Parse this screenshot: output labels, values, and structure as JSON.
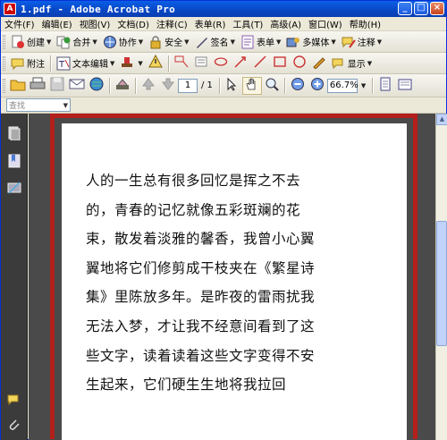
{
  "window": {
    "title": "1.pdf - Adobe Acrobat Pro",
    "controls": [
      "_",
      "□",
      "×"
    ]
  },
  "menu": [
    "文件(F)",
    "编辑(E)",
    "视图(V)",
    "文档(D)",
    "注释(C)",
    "表单(R)",
    "工具(T)",
    "高级(A)",
    "窗口(W)",
    "帮助(H)"
  ],
  "toolbar1": {
    "create": "创建",
    "combine": "合并",
    "collaborate": "协作",
    "secure": "安全",
    "sign": "签名",
    "forms": "表单",
    "multimedia": "多媒体",
    "comment": "注释"
  },
  "toolbar2": {
    "sticky_note": "附注",
    "text_edits": "文本编辑",
    "show": "显示"
  },
  "toolbar3": {
    "page_current": "1",
    "page_total": "/ 1",
    "zoom": "66.7%"
  },
  "search": {
    "placeholder": "查找"
  },
  "document": {
    "lines": [
      "人的一生总有很多回忆是挥之不去",
      "的，青春的记忆就像五彩斑斓的花",
      "束，散发着淡雅的馨香，我曾小心翼",
      "翼地将它们修剪成干枝夹在《繁星诗",
      "集》里陈放多年。是昨夜的雷雨扰我",
      "无法入梦，才让我不经意间看到了这",
      "些文字，读着读着这些文字变得不安",
      "生起来，它们硬生生地将我拉回"
    ]
  },
  "colors": {
    "title_bar": "#0846c4",
    "doc_bg": "#4a4a4a",
    "highlight_frame": "#b4201b"
  }
}
